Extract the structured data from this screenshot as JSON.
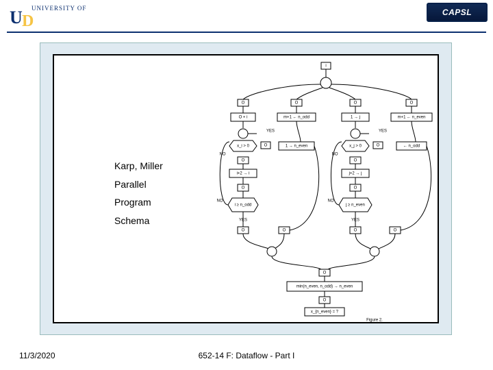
{
  "header": {
    "university_logo_text": "UNIVERSITY OF",
    "university_letter_left": "U",
    "university_letter_right": "D",
    "capsl_label": "CAPSL"
  },
  "caption": {
    "line1": "Karp, Miller",
    "line2": "Parallel",
    "line3": "Program",
    "line4": "Schema"
  },
  "figure": {
    "top_i": "i",
    "O": "O",
    "O_plus_i": "O + i",
    "m_plus_1_nodd": "m+1 ← n_odd",
    "one_arrow_j": "1 → j",
    "m_plus_1_neven": "m+1 ← n_even",
    "xi_gt_0": "x_i > 0",
    "yes": "YES",
    "no": "NO",
    "one_arrow_neven": "1 → n_even",
    "xj_gt_0": "x_j > 0",
    "arrow_nodd": "← n_odd",
    "i_plus_2_arrow_i": "i+2 → i",
    "j_plus_2_arrow_j": "j+2 → j",
    "i_ge_nodd": "i ≥ n_odd",
    "j_ge_neven": "j ≥ n_even",
    "min_expr": "min(n_even, n_odd) → n_even",
    "x_neven_q": "x_{n_even} = ?",
    "figure_label": "Figure 2."
  },
  "footer": {
    "date": "11/3/2020",
    "center": "652-14 F: Dataflow - Part I"
  }
}
